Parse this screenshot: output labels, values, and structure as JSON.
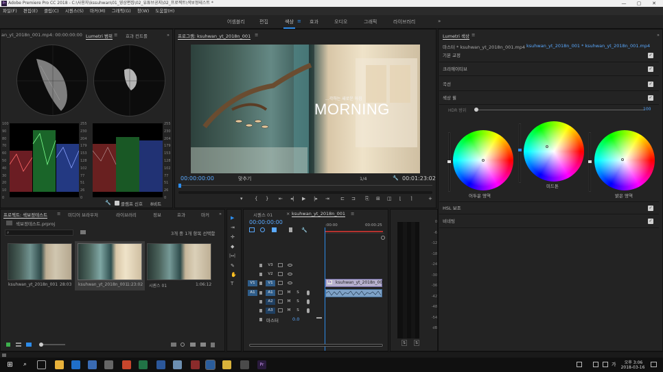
{
  "titlebar": {
    "title": "Adobe Premiere Pro CC 2018 - C:\\사용자\\kssuhwan\\01_영상편집\\02_유튜브공지\\02_프로젝트\\색보정테스트 *",
    "app_icon_label": "Pr",
    "minimize": "—",
    "maximize": "▢",
    "close": "✕"
  },
  "menubar": [
    "파일(F)",
    "편집(E)",
    "클립(C)",
    "시퀀스(S)",
    "마커(M)",
    "그래픽(G)",
    "창(W)",
    "도움말(H)"
  ],
  "workspaces": {
    "items": [
      "어셈블리",
      "편집",
      "색상",
      "효과",
      "오디오",
      "그래픽",
      "라이브러리"
    ],
    "active_index": 2,
    "active_menu_glyph": "≡",
    "overflow": "»"
  },
  "scopes": {
    "source_tab": "an_yt_2018n_001.mp4: 00:00:00:00",
    "tab_active": "Lumetri 범위",
    "tab_menu": "≡",
    "tab_other": "효과 컨트롤",
    "overflow": "»",
    "left_ticks": [
      "100",
      "90",
      "80",
      "70",
      "60",
      "50",
      "40",
      "30",
      "20",
      "10",
      "0"
    ],
    "right_ticks_a": [
      "255",
      "230",
      "204",
      "179",
      "153",
      "128",
      "102",
      "77",
      "51",
      "26",
      "0"
    ],
    "right_ticks_b": [
      "255",
      "230",
      "204",
      "179",
      "153",
      "128",
      "102",
      "77",
      "51",
      "26",
      "0"
    ],
    "clamp_label": "클램프 신호",
    "bit_label": "8비트",
    "wrench": "🔧"
  },
  "program": {
    "tab_label": "프로그램: ksuhwan_yt_2018n_001",
    "tab_menu": "≡",
    "overlay_small": "...각하는 새로운 아침",
    "overlay_big": "MORNING",
    "timecode_in": "00:00:00:00",
    "fit_label": "맞추기",
    "quality": "1/4",
    "timecode_out": "00:01:23:02",
    "controls": [
      "▾",
      "{",
      "}",
      "⇤",
      "◂|",
      "▶",
      "|▸",
      "⇥",
      "⊏",
      "⊐",
      "⎘",
      "⊞",
      "◫",
      "⌊",
      "⌉",
      "+"
    ]
  },
  "project": {
    "tab_active": "프로젝트: 색보정테스트",
    "tab_menu": "≡",
    "tabs": [
      "미디어 브라우저",
      "라이브러리",
      "정보",
      "효과",
      "마커"
    ],
    "overflow": "»",
    "file": "색보정테스트.prproj",
    "search_placeholder": "",
    "selection_info": "3개 중 1개 항목 선택함",
    "items": [
      {
        "name": "ksuhwan_yt_2018n_001",
        "duration": "28:03"
      },
      {
        "name": "ksuhwan_yt_2018n_001",
        "duration": "1:23:02"
      },
      {
        "name": "시퀀스 01",
        "duration": "1:06:12"
      }
    ]
  },
  "tools": [
    "▶",
    "⇥",
    "✛",
    "◆",
    "|↔|",
    "✎",
    "✋",
    "T"
  ],
  "timeline": {
    "tab_inactive": "시퀀스 01",
    "tab_active": "ksuhwan_yt_2018n_001",
    "tab_close": "×",
    "tab_menu": "≡",
    "timecode": "00:00:00:00",
    "ruler": [
      ":00:00",
      "00:00:25"
    ],
    "tracks": [
      {
        "name": "V3",
        "type": "video"
      },
      {
        "name": "V2",
        "type": "video"
      },
      {
        "name": "V1",
        "type": "video",
        "source": "V1"
      },
      {
        "name": "A1",
        "type": "audio",
        "source": "A1"
      },
      {
        "name": "A2",
        "type": "audio"
      },
      {
        "name": "A3",
        "type": "audio"
      }
    ],
    "master_label": "마스터",
    "master_value": "0.0",
    "clip_label": "ksuhwan_yt_2018n_001",
    "clip_fx": "fx",
    "audio_m": "M",
    "audio_s": "S"
  },
  "meter": {
    "ticks": [
      "0",
      "-6",
      "-12",
      "-18",
      "-24",
      "-30",
      "-36",
      "-42",
      "-48",
      "-54",
      "dB"
    ],
    "solo": [
      "S",
      "S"
    ]
  },
  "lumetri": {
    "tab_label": "Lumetri 색상",
    "tab_menu": "≡",
    "overflow": "»",
    "master_label": "마스터 * ksuhwan_yt_2018n_001.mp4",
    "master_seq": "ksuhwan_yt_2018n_001 * ksuhwan_yt_2018n_001.mp4",
    "sections": [
      "기본 교정",
      "크리에이티브",
      "곡선",
      "색상 휠"
    ],
    "hdr_label": "HDR 범위",
    "hdr_value": "100",
    "wheels": [
      "어두운 영역",
      "미드톤",
      "밝은 영역"
    ],
    "sections_after": [
      "HSL 보조",
      "비네팅"
    ],
    "check": "✓"
  },
  "taskbar": {
    "time": "오후 3:06",
    "date": "2018-03-16",
    "ime": "가",
    "start": "⊞",
    "search": "⌕"
  },
  "colors": {
    "accent": "#2d8ceb",
    "timecode": "#5aa9ff",
    "panel": "#232323",
    "track_source": "#2f5d8a"
  }
}
